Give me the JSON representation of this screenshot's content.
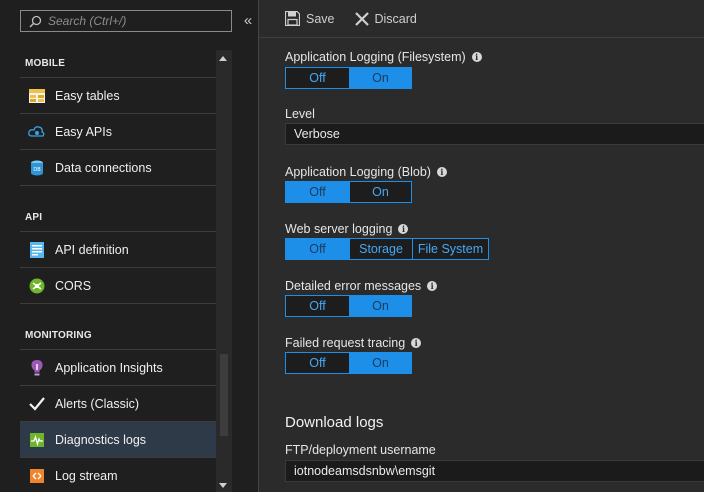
{
  "search": {
    "placeholder": "Search (Ctrl+/)"
  },
  "nav": {
    "sections": [
      {
        "header": "MOBILE",
        "items": [
          {
            "label": "Easy tables",
            "icon": "easy-tables-icon"
          },
          {
            "label": "Easy APIs",
            "icon": "easy-apis-icon"
          },
          {
            "label": "Data connections",
            "icon": "data-connections-icon"
          }
        ]
      },
      {
        "header": "API",
        "items": [
          {
            "label": "API definition",
            "icon": "api-definition-icon"
          },
          {
            "label": "CORS",
            "icon": "cors-icon"
          }
        ]
      },
      {
        "header": "MONITORING",
        "items": [
          {
            "label": "Application Insights",
            "icon": "application-insights-icon"
          },
          {
            "label": "Alerts (Classic)",
            "icon": "checkmark-icon"
          },
          {
            "label": "Diagnostics logs",
            "icon": "diagnostics-icon",
            "active": true
          },
          {
            "label": "Log stream",
            "icon": "log-stream-icon"
          }
        ]
      }
    ]
  },
  "toolbar": {
    "save_label": "Save",
    "discard_label": "Discard"
  },
  "settings": {
    "app_logging_fs": {
      "label": "Application Logging (Filesystem)",
      "options": [
        "Off",
        "On"
      ],
      "selected": "On"
    },
    "level": {
      "label": "Level",
      "value": "Verbose"
    },
    "app_logging_blob": {
      "label": "Application Logging (Blob)",
      "options": [
        "Off",
        "On"
      ],
      "selected": "Off"
    },
    "web_server_logging": {
      "label": "Web server logging",
      "options": [
        "Off",
        "Storage",
        "File System"
      ],
      "selected": "Off"
    },
    "detailed_errors": {
      "label": "Detailed error messages",
      "options": [
        "Off",
        "On"
      ],
      "selected": "On"
    },
    "failed_request": {
      "label": "Failed request tracing",
      "options": [
        "Off",
        "On"
      ],
      "selected": "On"
    }
  },
  "download_logs": {
    "title": "Download logs",
    "ftp_label": "FTP/deployment username",
    "ftp_value": "iotnodeamsdsnbw\\emsgit"
  },
  "colors": {
    "accent": "#1e8fe8",
    "background": "#2b2b2b",
    "nav_background": "#1f1f1f",
    "active_item": "#2e3a48"
  }
}
